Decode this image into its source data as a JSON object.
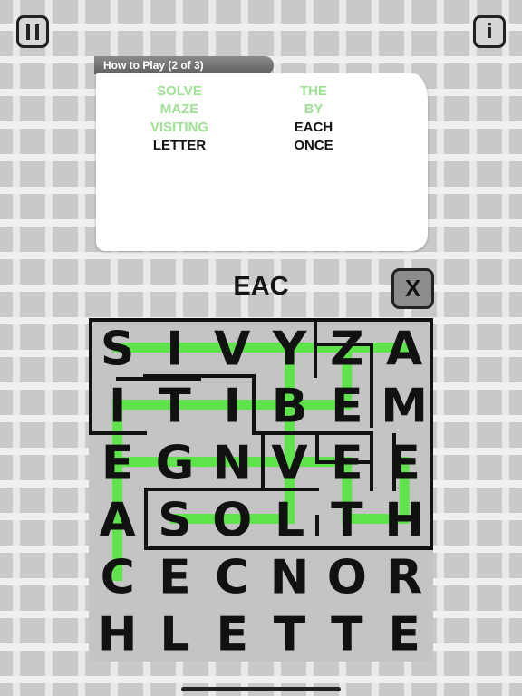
{
  "tutorial": {
    "tab_label": "How to Play (2 of 3)",
    "left_words": [
      {
        "text": "SOLVE",
        "done": true
      },
      {
        "text": "MAZE",
        "done": true
      },
      {
        "text": "VISITING",
        "done": true
      },
      {
        "text": "LETTER",
        "done": false
      }
    ],
    "right_words": [
      {
        "text": "THE",
        "done": true
      },
      {
        "text": "BY",
        "done": true
      },
      {
        "text": "EACH",
        "done": false
      },
      {
        "text": "ONCE",
        "done": false
      }
    ]
  },
  "current_word": "EAC",
  "clear_label": "X",
  "info_label": "i",
  "grid": {
    "rows": [
      [
        "S",
        "I",
        "V",
        "Y",
        "Z",
        "A"
      ],
      [
        "I",
        "T",
        "I",
        "B",
        "E",
        "M"
      ],
      [
        "E",
        "G",
        "N",
        "V",
        "E",
        "E"
      ],
      [
        "A",
        "S",
        "O",
        "L",
        "T",
        "H"
      ],
      [
        "C",
        "E",
        "C",
        "N",
        "O",
        "R"
      ],
      [
        "H",
        "L",
        "E",
        "T",
        "T",
        "E"
      ]
    ]
  },
  "colors": {
    "path": "#5fe34a",
    "maze": "#111111",
    "board": "#c4c4c4"
  }
}
